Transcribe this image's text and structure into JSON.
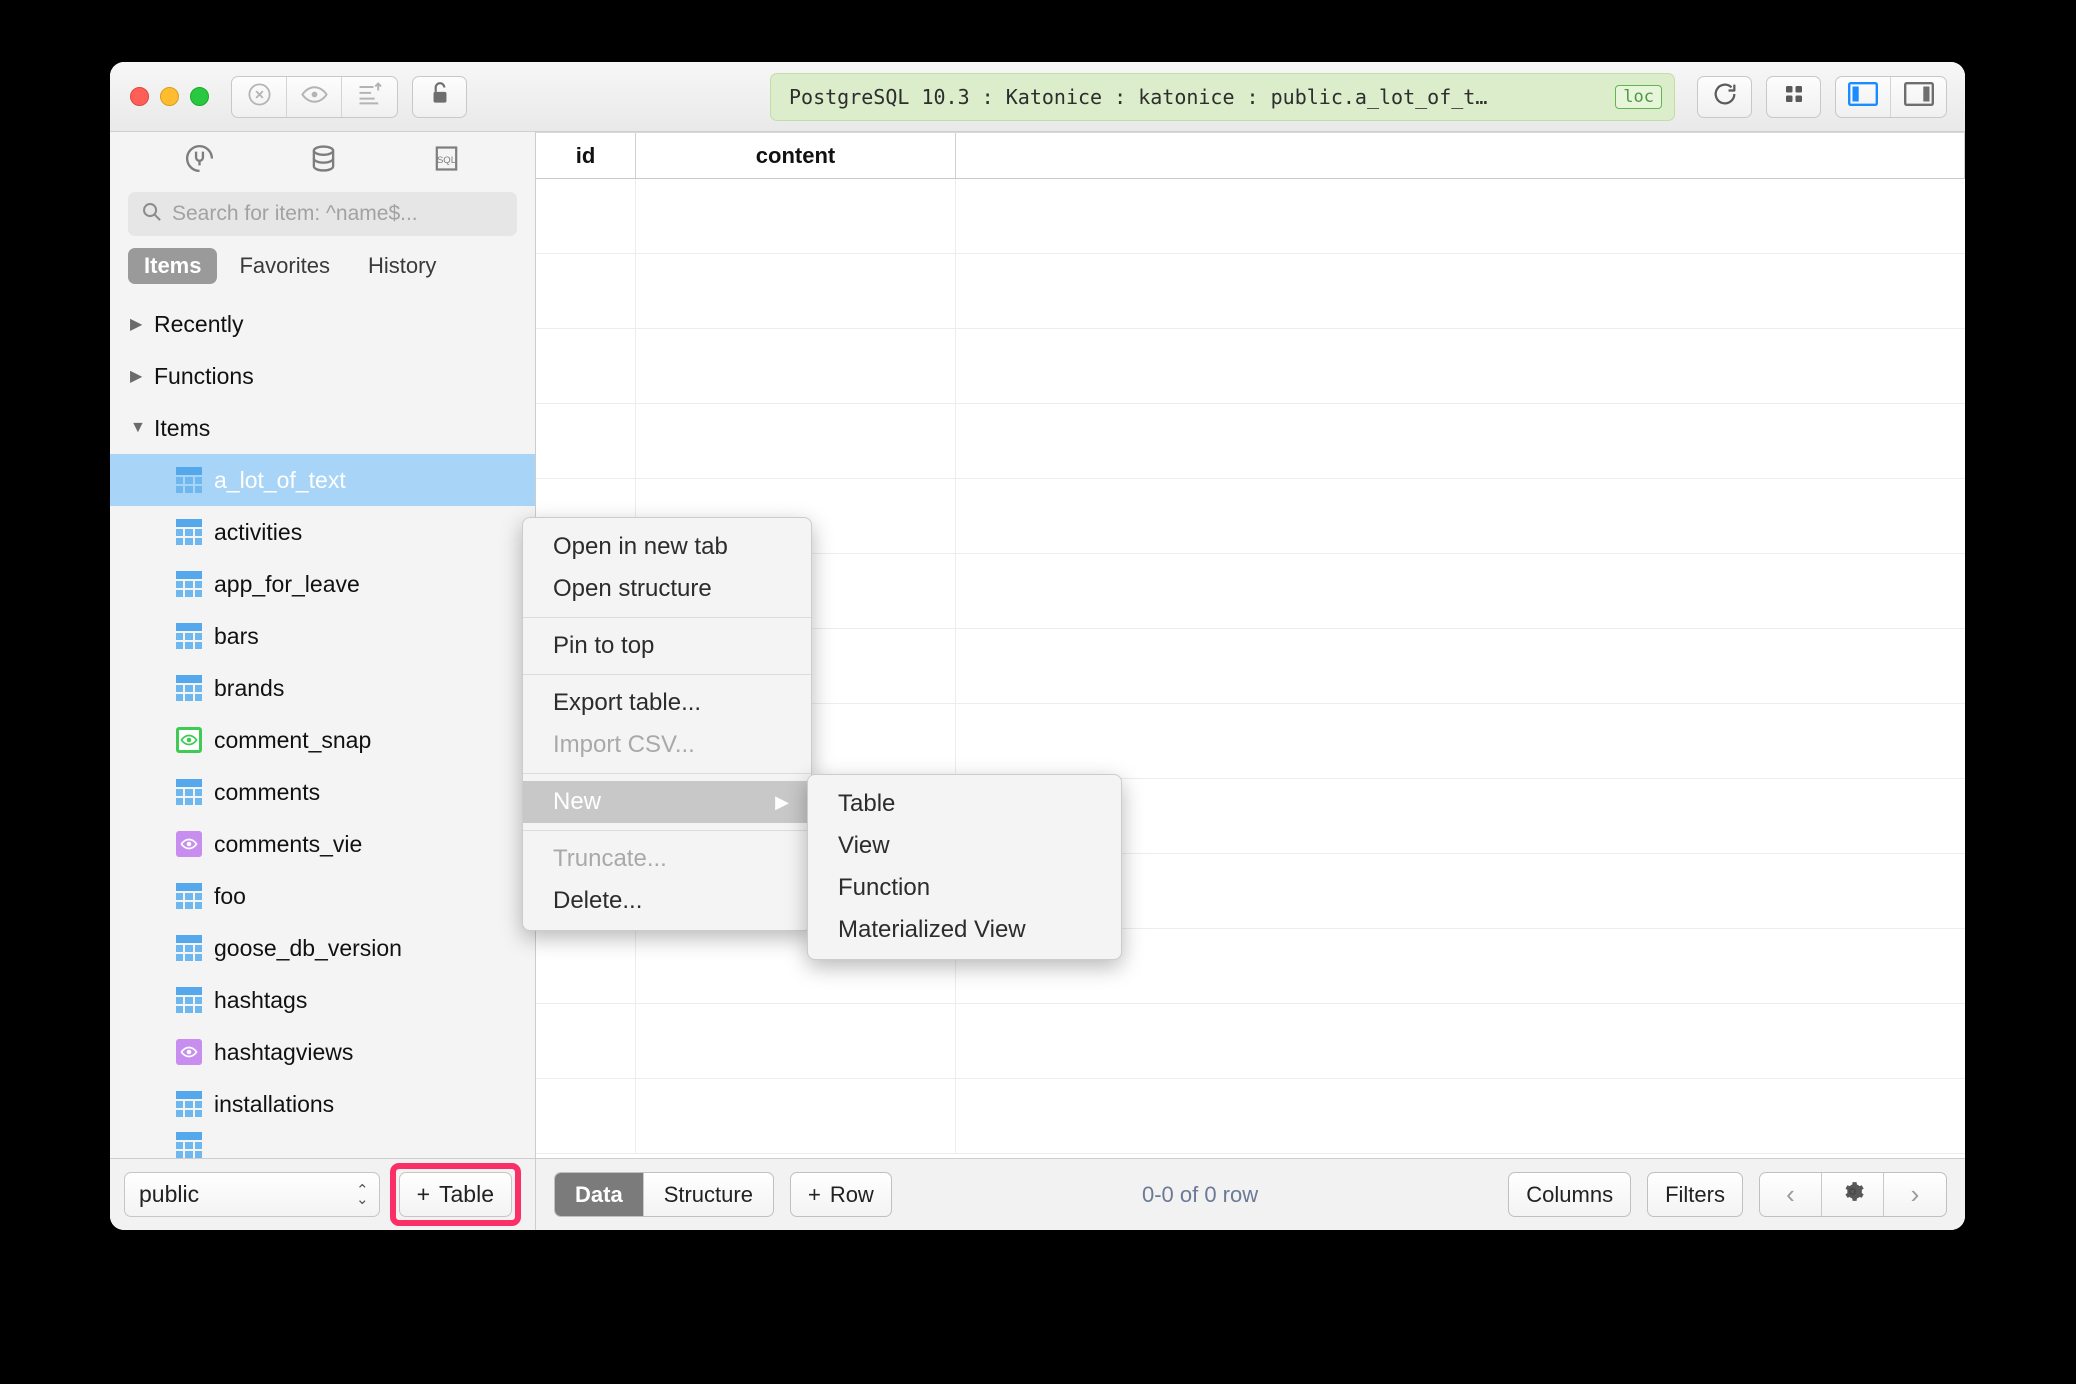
{
  "titlebar": {
    "path": "PostgreSQL 10.3 : Katonice : katonice : public.a_lot_of_t…",
    "loc_badge": "loc",
    "close_icon": "close-circle-icon",
    "eye_icon": "eye-icon",
    "sort_icon": "sort-ascending-icon",
    "lock_icon": "unlocked-padlock-icon",
    "refresh_icon": "refresh-icon",
    "grid_icon": "grid-view-icon",
    "left_panel_icon": "left-sidebar-toggle-icon",
    "right_panel_icon": "right-sidebar-toggle-icon"
  },
  "sidebar": {
    "icons": [
      {
        "name": "connections-plug-icon",
        "label": "Connections"
      },
      {
        "name": "database-icon",
        "label": "Database"
      },
      {
        "name": "sql-query-icon",
        "label": "SQL"
      }
    ],
    "search": {
      "placeholder": "Search for item: ^name$...",
      "value": "",
      "icon": "search-icon"
    },
    "tabs": [
      {
        "label": "Items",
        "active": true
      },
      {
        "label": "Favorites",
        "active": false
      },
      {
        "label": "History",
        "active": false
      }
    ],
    "groups": [
      {
        "label": "Recently",
        "expanded": false
      },
      {
        "label": "Functions",
        "expanded": false
      },
      {
        "label": "Items",
        "expanded": true
      }
    ],
    "items": [
      {
        "label": "a_lot_of_text",
        "type": "table",
        "selected": true
      },
      {
        "label": "activities",
        "type": "table",
        "selected": false
      },
      {
        "label": "app_for_leave",
        "type": "table",
        "selected": false
      },
      {
        "label": "bars",
        "type": "table",
        "selected": false
      },
      {
        "label": "brands",
        "type": "table",
        "selected": false
      },
      {
        "label": "comment_snap",
        "type": "matview",
        "selected": false
      },
      {
        "label": "comments",
        "type": "table",
        "selected": false
      },
      {
        "label": "comments_vie",
        "type": "view",
        "selected": false
      },
      {
        "label": "foo",
        "type": "table",
        "selected": false
      },
      {
        "label": "goose_db_version",
        "type": "table",
        "selected": false
      },
      {
        "label": "hashtags",
        "type": "table",
        "selected": false
      },
      {
        "label": "hashtagviews",
        "type": "view",
        "selected": false
      },
      {
        "label": "installations",
        "type": "table",
        "selected": false
      }
    ],
    "bottom": {
      "schema_value": "public",
      "add_table_label": "Table",
      "add_table_plus": "+",
      "stepper_icon": "stepper-updown-icon"
    }
  },
  "context_menu": {
    "items": [
      {
        "label": "Open in new tab",
        "disabled": false,
        "highlighted": false,
        "submenu": false
      },
      {
        "label": "Open structure",
        "disabled": false,
        "highlighted": false,
        "submenu": false
      },
      {
        "separator": true
      },
      {
        "label": "Pin to top",
        "disabled": false,
        "highlighted": false,
        "submenu": false
      },
      {
        "separator": true
      },
      {
        "label": "Export table...",
        "disabled": false,
        "highlighted": false,
        "submenu": false
      },
      {
        "label": "Import CSV...",
        "disabled": true,
        "highlighted": false,
        "submenu": false
      },
      {
        "separator": true
      },
      {
        "label": "New",
        "disabled": false,
        "highlighted": true,
        "submenu": true,
        "arrow": "▶"
      },
      {
        "separator": true
      },
      {
        "label": "Truncate...",
        "disabled": true,
        "highlighted": false,
        "submenu": false
      },
      {
        "label": "Delete...",
        "disabled": false,
        "highlighted": false,
        "submenu": false
      }
    ],
    "submenu": {
      "items": [
        {
          "label": "Table"
        },
        {
          "label": "View"
        },
        {
          "label": "Function"
        },
        {
          "label": "Materialized View"
        }
      ]
    }
  },
  "grid": {
    "columns": [
      "id",
      "content",
      ""
    ],
    "rows": [],
    "empty_row_count": 13
  },
  "main_bottom": {
    "view_tabs": [
      {
        "label": "Data",
        "active": true
      },
      {
        "label": "Structure",
        "active": false
      }
    ],
    "add_row_label": "Row",
    "add_row_plus": "+",
    "row_count": "0-0 of 0 row",
    "columns_label": "Columns",
    "filters_label": "Filters",
    "prev_icon": "chevron-left-icon",
    "gear_icon": "gear-icon",
    "next_icon": "chevron-right-icon"
  },
  "colors": {
    "selection_blue": "#a8d4f7",
    "path_green_bg": "#dbedca",
    "path_green_border": "#c3dca8",
    "loc_green": "#4c9a3f",
    "highlight_pink": "#fb2f68",
    "menu_highlight": "#c8c8c8",
    "table_icon_blue": "#6fb7ef",
    "view_icon_purple": "#c78ef0",
    "matview_icon_green": "#3dcb53",
    "active_panel_blue": "#1a8cff"
  }
}
